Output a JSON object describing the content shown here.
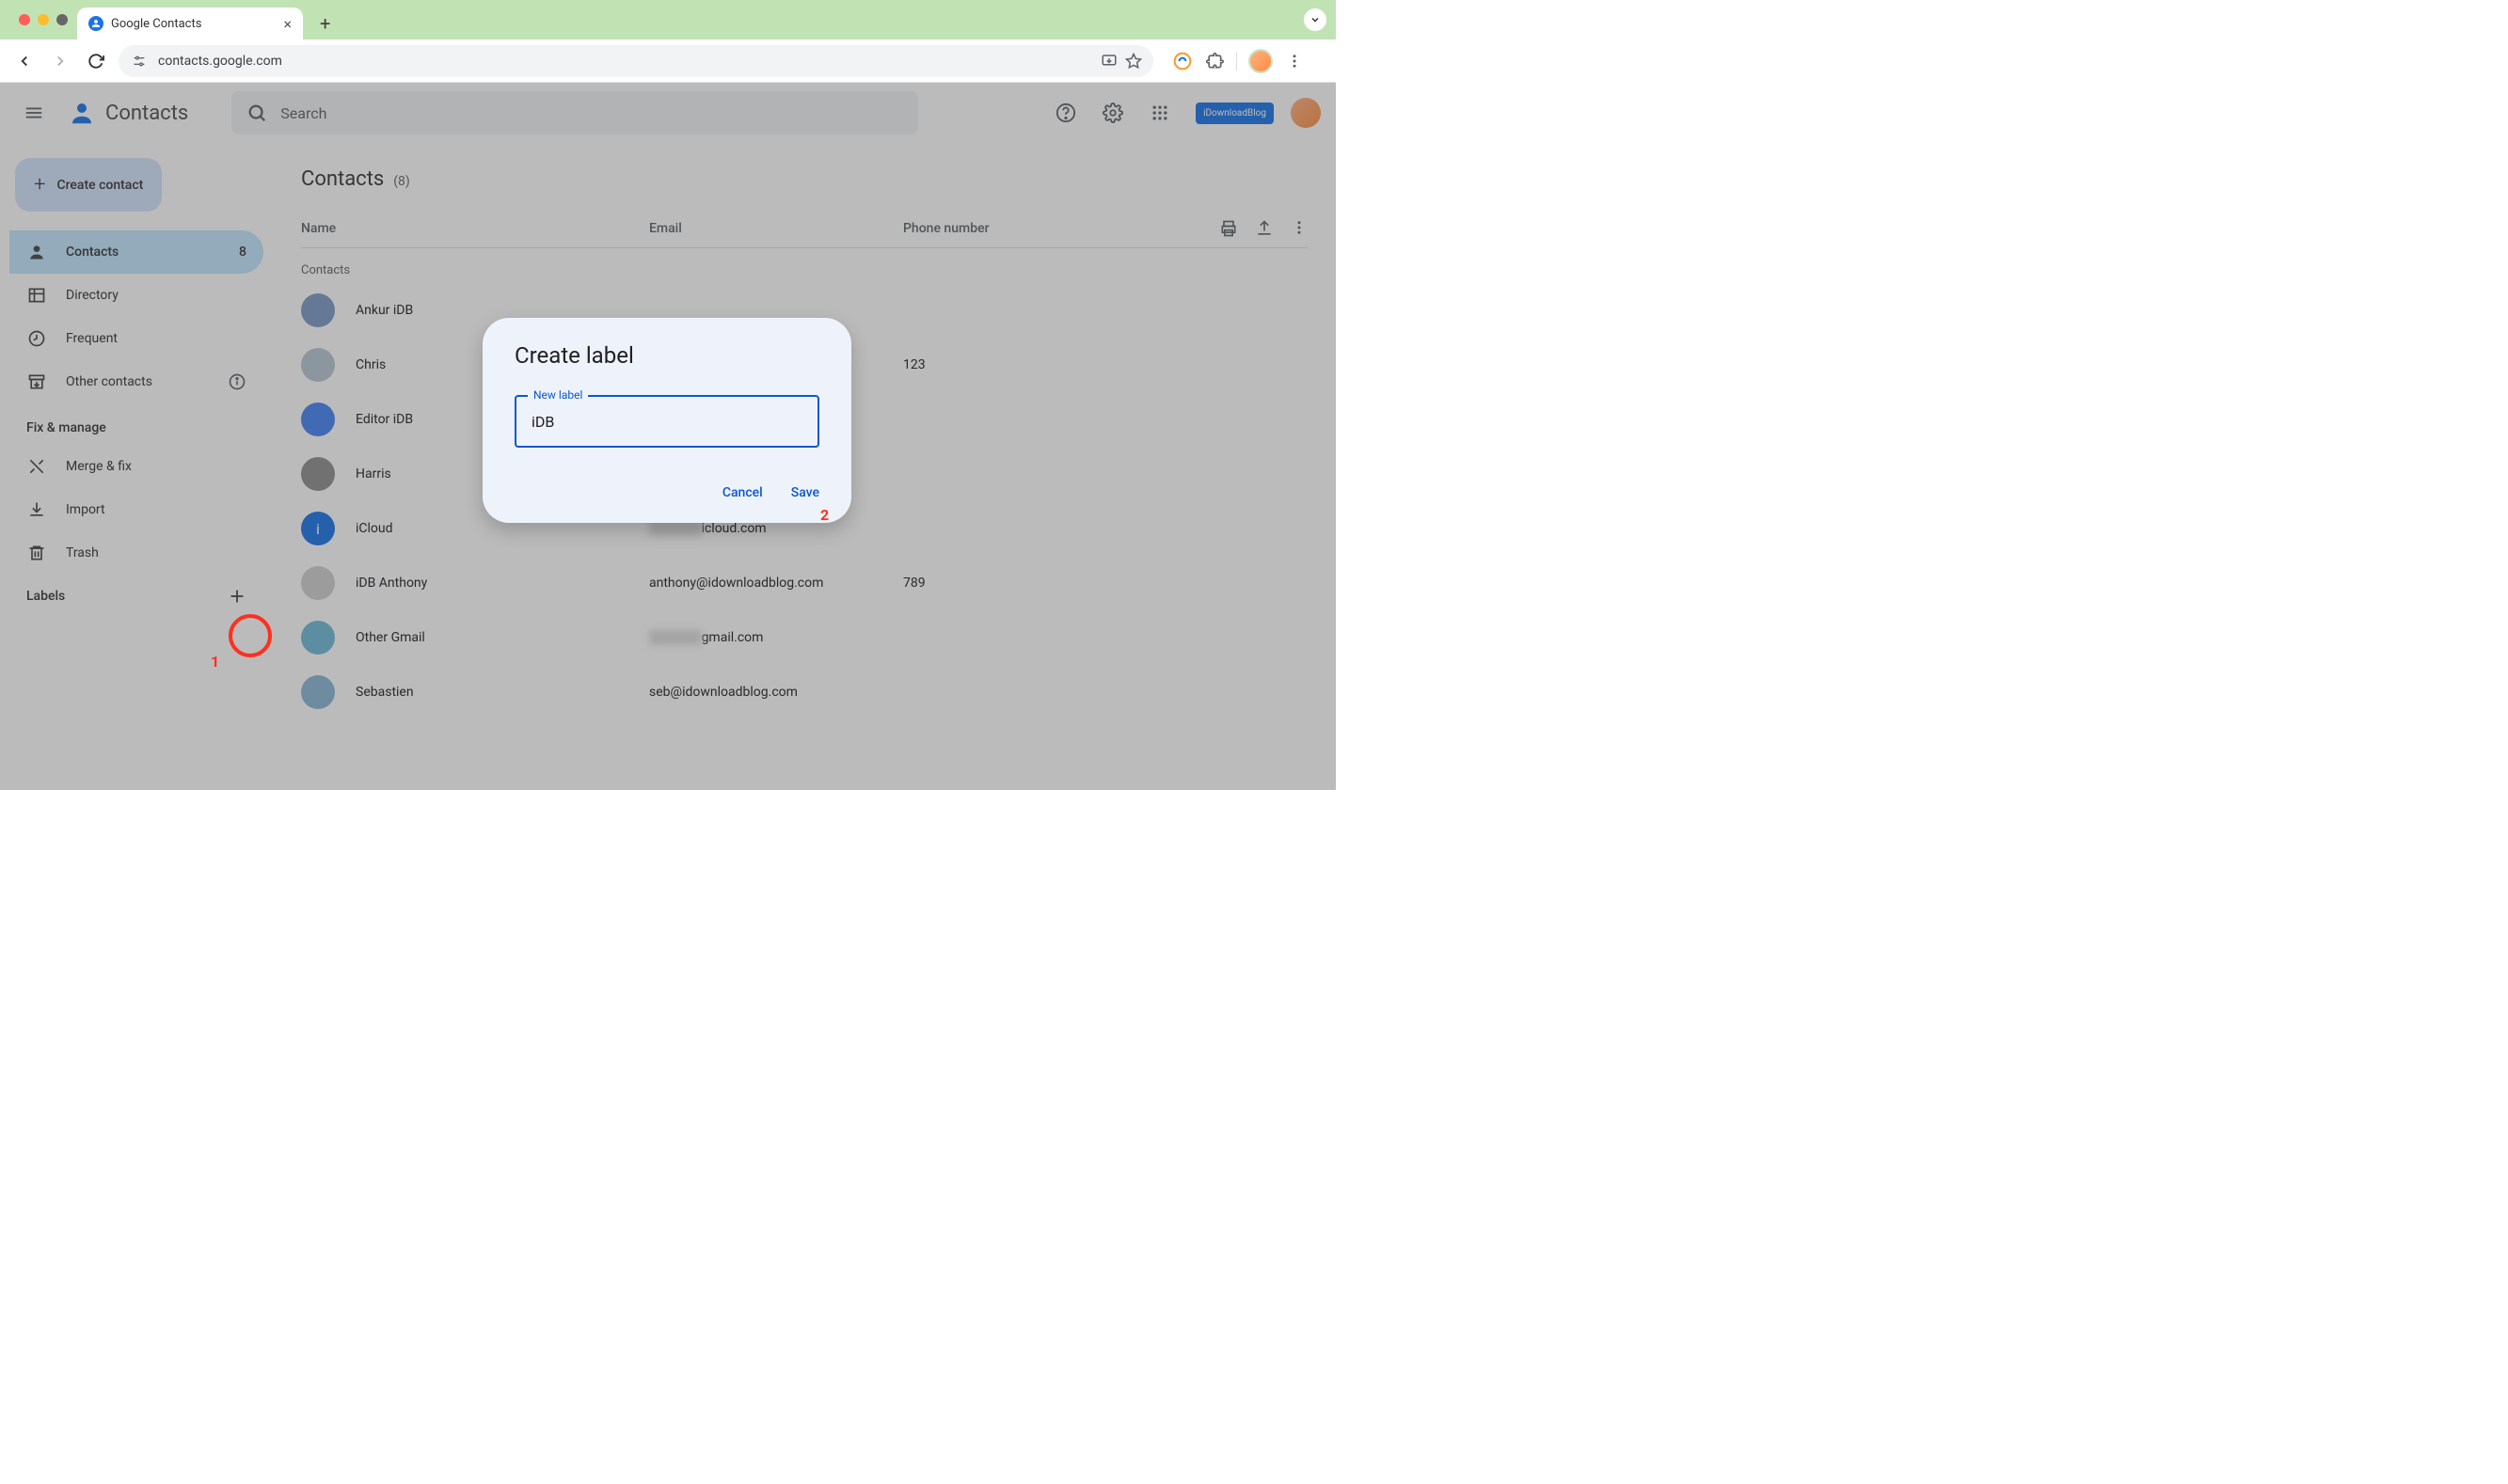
{
  "browser": {
    "tab_title": "Google Contacts",
    "url": "contacts.google.com"
  },
  "header": {
    "app_name": "Contacts",
    "search_placeholder": "Search",
    "badge_text": "iDownloadBlog"
  },
  "sidebar": {
    "create_contact": "Create contact",
    "items": [
      {
        "icon": "person",
        "label": "Contacts",
        "count": "8",
        "active": true
      },
      {
        "icon": "directory",
        "label": "Directory"
      },
      {
        "icon": "frequent",
        "label": "Frequent"
      },
      {
        "icon": "archive",
        "label": "Other contacts",
        "info": true
      }
    ],
    "fix_manage_title": "Fix & manage",
    "fix_items": [
      {
        "icon": "merge",
        "label": "Merge & fix"
      },
      {
        "icon": "import",
        "label": "Import"
      },
      {
        "icon": "trash",
        "label": "Trash"
      }
    ],
    "labels_title": "Labels"
  },
  "main": {
    "title": "Contacts",
    "count_display": "(8)",
    "columns": {
      "name": "Name",
      "email": "Email",
      "phone": "Phone number"
    },
    "section_label": "Contacts",
    "contacts": [
      {
        "name": "Ankur iDB",
        "email": "",
        "phone": "",
        "avatar_bg": "#7b9ac7"
      },
      {
        "name": "Chris",
        "email": "",
        "phone": "123",
        "avatar_bg": "#b5c7d3"
      },
      {
        "name": "Editor iDB",
        "email": "",
        "phone": "",
        "avatar_bg": "#4285f4"
      },
      {
        "name": "Harris",
        "email": "",
        "phone": "",
        "avatar_bg": "#8e8e8e"
      },
      {
        "name": "iCloud",
        "email_suffix": "icloud.com",
        "email_blur": true,
        "phone": "",
        "avatar_bg": "#1a73e8",
        "initial": "i"
      },
      {
        "name": "iDB Anthony",
        "email": "anthony@idownloadblog.com",
        "phone": "789",
        "avatar_bg": "#d0d0d0"
      },
      {
        "name": "Other Gmail",
        "email_suffix": "gmail.com",
        "email_blur": true,
        "phone": "",
        "avatar_bg": "#6fb8d6"
      },
      {
        "name": "Sebastien",
        "email": "seb@idownloadblog.com",
        "phone": "",
        "avatar_bg": "#8bb5d4"
      }
    ]
  },
  "dialog": {
    "title": "Create label",
    "field_label": "New label",
    "field_value": "iDB",
    "cancel": "Cancel",
    "save": "Save"
  },
  "annotations": {
    "num1": "1",
    "num2": "2"
  }
}
